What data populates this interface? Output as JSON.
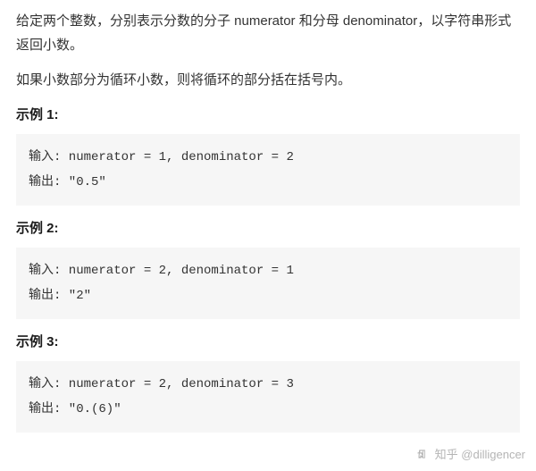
{
  "problem": {
    "paragraph1": "给定两个整数，分别表示分数的分子 numerator 和分母 denominator，以字符串形式返回小数。",
    "paragraph2": "如果小数部分为循环小数，则将循环的部分括在括号内。"
  },
  "examples": [
    {
      "heading": "示例 1:",
      "input_line": "输入: numerator = 1, denominator = 2",
      "output_line": "输出: \"0.5\""
    },
    {
      "heading": "示例 2:",
      "input_line": "输入: numerator = 2, denominator = 1",
      "output_line": "输出: \"2\""
    },
    {
      "heading": "示例 3:",
      "input_line": "输入: numerator = 2, denominator = 3",
      "output_line": "输出: \"0.(6)\""
    }
  ],
  "watermark": {
    "label": "知乎 @dilligencer"
  }
}
